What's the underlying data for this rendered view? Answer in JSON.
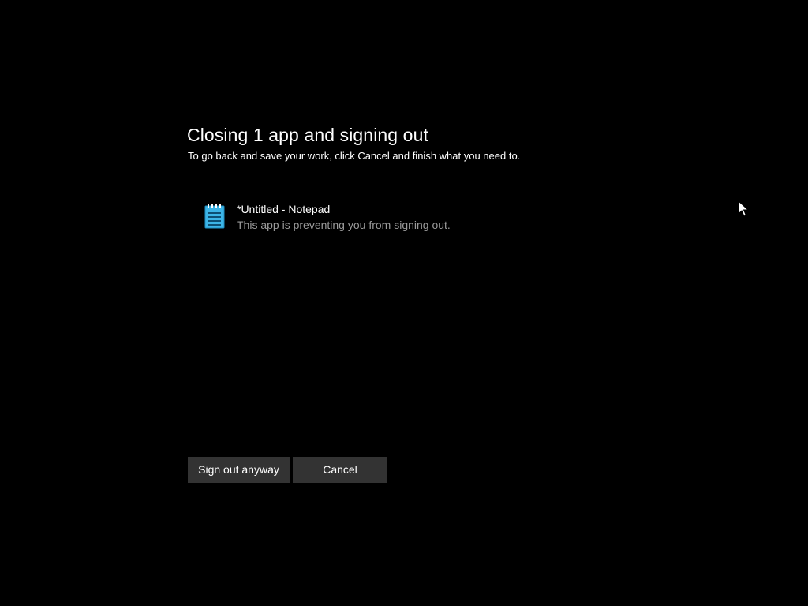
{
  "dialog": {
    "title": "Closing 1 app and signing out",
    "subtitle": "To go back and save your work, click Cancel and finish what you need to."
  },
  "apps": [
    {
      "name": "*Untitled - Notepad",
      "status": "This app is preventing you from signing out.",
      "icon": "notepad-icon"
    }
  ],
  "buttons": {
    "sign_out_label": "Sign out anyway",
    "cancel_label": "Cancel"
  },
  "colors": {
    "background": "#000000",
    "button": "#333333",
    "text": "#ffffff",
    "secondary_text": "#9a9a9a",
    "icon_accent": "#3cb4e6"
  }
}
